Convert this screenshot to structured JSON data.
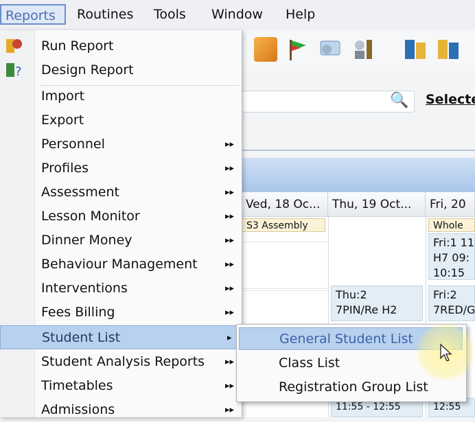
{
  "menubar": {
    "items": [
      {
        "label": "Reports",
        "active": true
      },
      {
        "label": "Routines"
      },
      {
        "label": "Tools"
      },
      {
        "label": "Window"
      },
      {
        "label": "Help"
      }
    ]
  },
  "background": {
    "select_label": "Selecte",
    "columns": [
      "Ved, 18 Oc...",
      "Thu, 19 Oct...",
      "Fri, 20 "
    ],
    "chips": [
      "S3 Assembly",
      "Whole"
    ],
    "slots": [
      "Fri:1 11\nH7 09:\n10:15",
      "Thu:2\n7PIN/Re H2",
      "Fri:2\n7RED/G"
    ],
    "slot_partial": [
      "11:55 - 12:55",
      "12:55"
    ]
  },
  "reports_menu": {
    "items": [
      {
        "label": "Run Report",
        "icon": "run-report-icon"
      },
      {
        "label": "Design Report",
        "icon": "design-report-icon"
      },
      {
        "label": "Import"
      },
      {
        "label": "Export"
      },
      {
        "label": "Personnel",
        "submenu": true
      },
      {
        "label": "Profiles",
        "submenu": true
      },
      {
        "label": "Assessment",
        "submenu": true
      },
      {
        "label": "Lesson Monitor",
        "submenu": true
      },
      {
        "label": "Dinner Money",
        "submenu": true
      },
      {
        "label": "Behaviour Management",
        "submenu": true
      },
      {
        "label": "Interventions",
        "submenu": true
      },
      {
        "label": "Fees Billing",
        "submenu": true
      },
      {
        "label": "Student List",
        "submenu": true,
        "highlighted": true
      },
      {
        "label": "Student Analysis Reports",
        "submenu": true
      },
      {
        "label": "Timetables",
        "submenu": true
      },
      {
        "label": "Admissions",
        "submenu": true
      }
    ]
  },
  "student_list_submenu": {
    "items": [
      {
        "label": "General Student List",
        "highlighted": true
      },
      {
        "label": "Class List"
      },
      {
        "label": "Registration Group List"
      }
    ]
  },
  "colors": {
    "highlight": "#b8d1ee",
    "header_blue": "#a9c6ea",
    "active_menu_text": "#4a6fb0"
  }
}
